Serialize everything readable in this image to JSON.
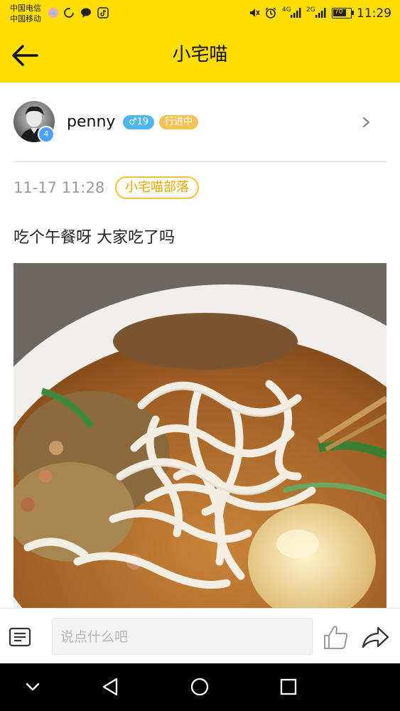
{
  "status_bar": {
    "carrier1": "中国电信",
    "carrier2": "中国移动",
    "network1": "4G",
    "network2": "2G",
    "battery": "70",
    "time": "11:29"
  },
  "header": {
    "title": "小宅喵",
    "accent_color": "#ffde00"
  },
  "author": {
    "username": "penny",
    "level": "4",
    "gender_age": "♂19",
    "status": "行进中"
  },
  "post": {
    "timestamp": "11-17 11:28",
    "tribe": "小宅喵部落",
    "text": "吃个午餐呀 大家吃了吗"
  },
  "comment_bar": {
    "placeholder": "说点什么吧"
  },
  "icons": {
    "back": "arrow-left-icon",
    "chevron": "chevron-right-icon",
    "comment": "comment-list-icon",
    "like": "thumbs-up-icon",
    "share": "share-arrow-icon"
  }
}
